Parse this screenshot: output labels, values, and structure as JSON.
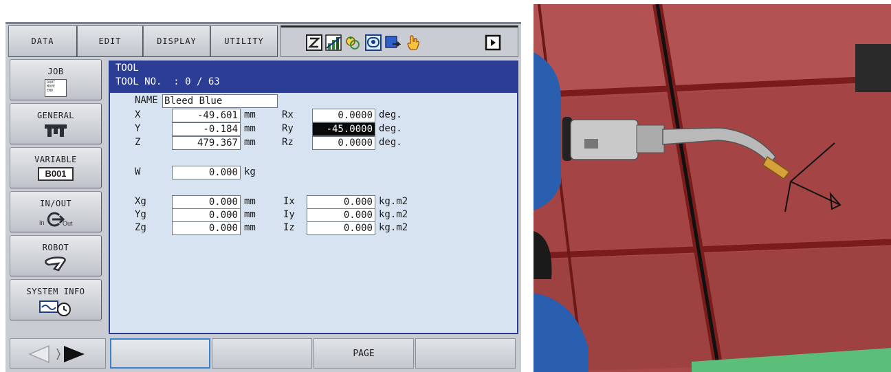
{
  "menu": {
    "data": "DATA",
    "edit": "EDIT",
    "display": "DISPLAY",
    "utility": "UTILITY"
  },
  "toolbar_icons": [
    "edit-toggle-icon",
    "signal-chart-icon",
    "interlock-icon",
    "io-monitor-icon",
    "screen-export-icon",
    "hand-hold-icon",
    "play-next-icon"
  ],
  "side_menu": {
    "job": "JOB",
    "job_badge_lines": [
      "DOUT",
      "MOVE",
      "END"
    ],
    "general": "GENERAL",
    "variable": "VARIABLE",
    "variable_badge": "B001",
    "inout": "IN/OUT",
    "inout_in": "In",
    "inout_out": "Out",
    "robot": "ROBOT",
    "system_info": "SYSTEM INFO"
  },
  "header": {
    "title": "TOOL",
    "tool_no": "TOOL NO.  : 0 / 63"
  },
  "tool": {
    "name_label": "NAME",
    "name_value": "Bleed Blue",
    "x_label": "X",
    "x": "-49.601",
    "y_label": "Y",
    "y": "-0.184",
    "z_label": "Z",
    "z": "479.367",
    "rx_label": "Rx",
    "rx": "0.0000",
    "ry_label": "Ry",
    "ry": "-45.0000",
    "rz_label": "Rz",
    "rz": "0.0000",
    "w_label": "W",
    "w": "0.000",
    "xg_label": "Xg",
    "xg": "0.000",
    "yg_label": "Yg",
    "yg": "0.000",
    "zg_label": "Zg",
    "zg": "0.000",
    "ix_label": "Ix",
    "ix": "0.000",
    "iy_label": "Iy",
    "iy": "0.000",
    "iz_label": "Iz",
    "iz": "0.000",
    "unit_mm": "mm",
    "unit_deg": "deg.",
    "unit_kg": "kg",
    "unit_kgm2": "kg.m2"
  },
  "bottom": {
    "page": "PAGE"
  },
  "colors": {
    "header_blue": "#2c3d95",
    "content_bg": "#d7e3f1",
    "floor_red": "#a84747",
    "beam_dark": "#7a1c1c",
    "robot_blue": "#2a5fb0"
  }
}
